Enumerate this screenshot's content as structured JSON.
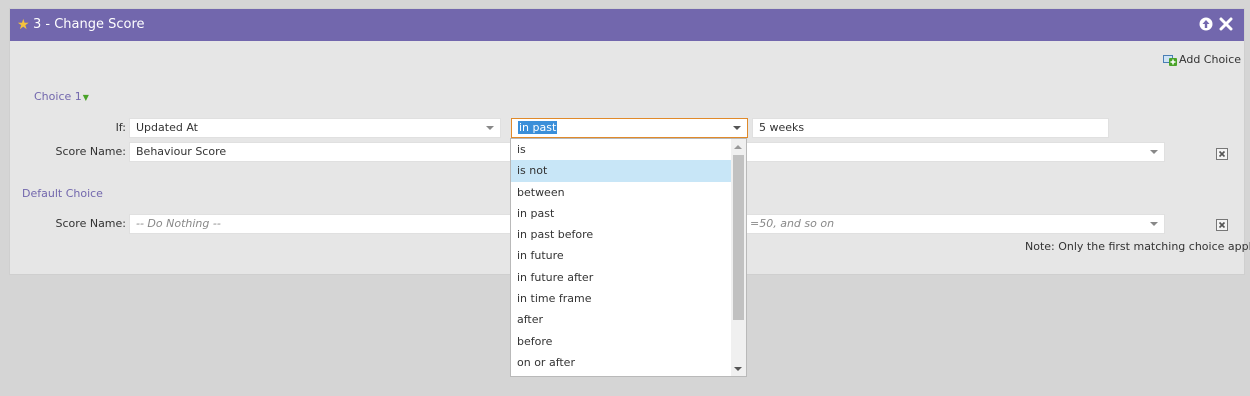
{
  "dialog": {
    "title": "3 - Change Score",
    "add_choice_label": "Add Choice"
  },
  "choice1": {
    "label": "Choice 1",
    "if_label": "If:",
    "attribute_value": "Updated At",
    "operator_value": "in past",
    "operand_value": "5 weeks",
    "score_name_label": "Score Name:",
    "score_name_value": "Behaviour Score"
  },
  "default_choice": {
    "label": "Default Choice",
    "score_name_label": "Score Name:",
    "score_name_value": "-- Do Nothing --",
    "change_placeholder": "=50, and so on"
  },
  "note": "Note: Only the first matching choice applies",
  "operator_dropdown": {
    "options": [
      "is",
      "is not",
      "between",
      "in past",
      "in past before",
      "in future",
      "in future after",
      "in time frame",
      "after",
      "before",
      "on or after"
    ],
    "highlighted": "is not"
  },
  "colors": {
    "title_bar": "#7267ad",
    "link": "#7267ad",
    "highlight": "#c8e6f7",
    "selection": "#3b8fd9",
    "active_border": "#e08a2a"
  },
  "icons": {
    "star": "star-icon",
    "move_up": "arrow-up-circle-icon",
    "close": "close-icon",
    "add_choice": "add-choice-icon",
    "delete": "delete-box-icon"
  }
}
